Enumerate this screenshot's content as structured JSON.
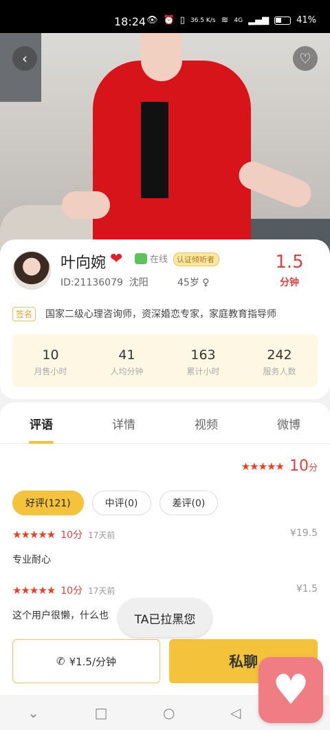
{
  "status": {
    "time": "18:24",
    "network_speed": "36.5 K/s",
    "signal": "4G",
    "battery": "41%"
  },
  "profile": {
    "name": "叶向婉",
    "online": "在线",
    "certified": "认证倾听者",
    "id_text": "ID:21136079",
    "city": "沈阳",
    "age": "45岁",
    "price": "1.5",
    "price_unit": "分钟",
    "sign_tag": "签名",
    "signature": "国家二级心理咨询师，资深婚恋专家，家庭教育指导师"
  },
  "stats": [
    {
      "value": "10",
      "label": "月售小时"
    },
    {
      "value": "41",
      "label": "人均分钟"
    },
    {
      "value": "163",
      "label": "累计小时"
    },
    {
      "value": "242",
      "label": "服务人数"
    }
  ],
  "tabs": [
    "评语",
    "详情",
    "视频",
    "微博"
  ],
  "rating": {
    "stars": 5,
    "score": "10",
    "score_unit": "分"
  },
  "filters": [
    "好评(121)",
    "中评(0)",
    "差评(0)"
  ],
  "reviews": [
    {
      "points": "10分",
      "time": "17天前",
      "amount": "¥19.5",
      "text": "专业耐心"
    },
    {
      "points": "10分",
      "time": "17天前",
      "amount": "¥1.5",
      "text": "这个用户很懒，什么也"
    }
  ],
  "toast": "TA已拉黑您",
  "actions": {
    "call": "¥1.5/分钟",
    "chat": "私聊"
  },
  "colors": {
    "accent": "#f4c23b",
    "price_red": "#e04040",
    "star": "#f23c1e"
  },
  "icons": {
    "back": "chevron-left-icon",
    "favorite": "heart-outline-icon",
    "phone": "phone-icon",
    "gender": "female-icon"
  }
}
